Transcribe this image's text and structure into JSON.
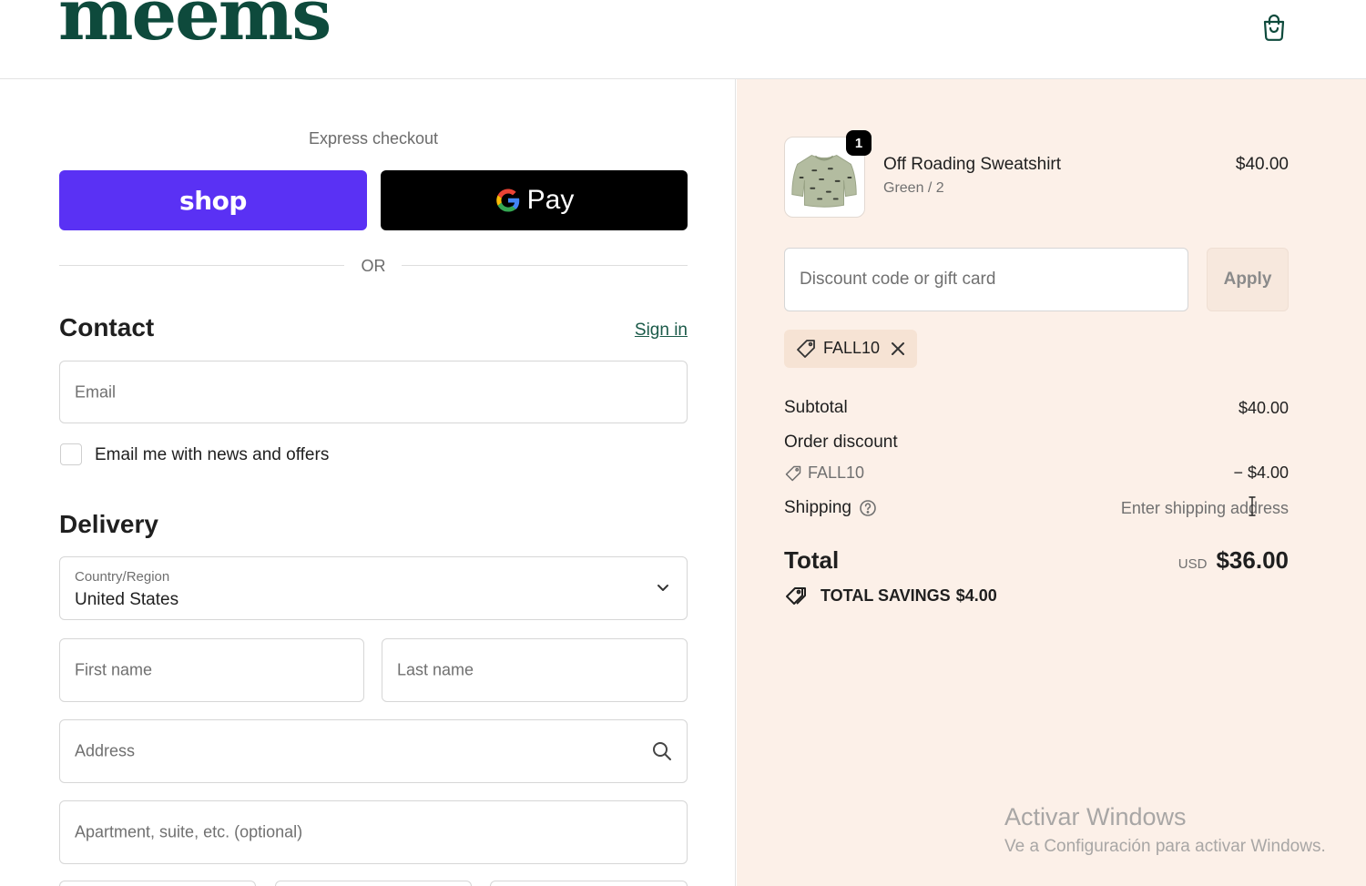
{
  "header": {
    "logo": "meems",
    "cart_icon": "shopping-bag-icon"
  },
  "express": {
    "title": "Express checkout",
    "shop_label": "shop",
    "gpay_label": "Pay",
    "or_label": "OR",
    "colors": {
      "shop": "#5a31f4",
      "gpay": "#000000"
    }
  },
  "contact": {
    "title": "Contact",
    "signin": "Sign in",
    "email_placeholder": "Email",
    "newsletter_label": "Email me with news and offers"
  },
  "delivery": {
    "title": "Delivery",
    "country_label": "Country/Region",
    "country_value": "United States",
    "first_name_placeholder": "First name",
    "last_name_placeholder": "Last name",
    "address_placeholder": "Address",
    "apartment_placeholder": "Apartment, suite, etc. (optional)"
  },
  "summary": {
    "product": {
      "name": "Off Roading Sweatshirt",
      "variant": "Green / 2",
      "price": "$40.00",
      "quantity": "1"
    },
    "discount_placeholder": "Discount code or gift card",
    "apply_label": "Apply",
    "applied_code": "FALL10",
    "subtotal_label": "Subtotal",
    "subtotal_value": "$40.00",
    "order_discount_label": "Order discount",
    "discount_code": "FALL10",
    "discount_value": "− $4.00",
    "shipping_label": "Shipping",
    "shipping_value": "Enter shipping address",
    "total_label": "Total",
    "total_currency": "USD",
    "total_value": "$36.00",
    "savings_label": "TOTAL SAVINGS",
    "savings_value": "$4.00"
  },
  "watermark": {
    "line1": "Activar Windows",
    "line2": "Ve a Configuración para activar Windows."
  },
  "colors": {
    "brand": "#0e4a3c",
    "summary_bg": "#fcf0e8",
    "link": "#1b5a49"
  }
}
